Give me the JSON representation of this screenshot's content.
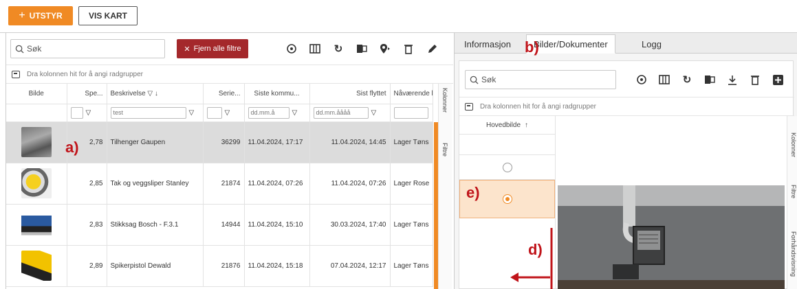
{
  "toolbar": {
    "add_label": "UTSTYR",
    "add_plus": "+",
    "map_label": "VIS KART"
  },
  "left": {
    "search_placeholder": "Søk",
    "clear_label": "Fjern alle filtre",
    "clear_icon": "✕",
    "group_hint": "Dra kolonnen hit for å angi radgrupper",
    "columns": [
      "Bilde",
      "Spe...",
      "Beskrivelse",
      "Serie...",
      "Siste kommu...",
      "Sist flyttet",
      "Nåværende l"
    ],
    "desc_sort": "▽ ↓",
    "filter": {
      "desc_value": "test",
      "date1": "dd.mm.å",
      "date2": "dd.mm.åååå"
    },
    "rows": [
      {
        "spe": "2,78",
        "desc": "Tilhenger Gaupen",
        "serial": "36299",
        "last_comm": "11.04.2024, 17:17",
        "last_moved": "11.04.2024, 14:45",
        "location": "Lager Tøns"
      },
      {
        "spe": "2,85",
        "desc": "Tak og veggsliper Stanley",
        "serial": "21874",
        "last_comm": "11.04.2024, 07:26",
        "last_moved": "11.04.2024, 07:26",
        "location": "Lager Rose"
      },
      {
        "spe": "2,83",
        "desc": "Stikksag Bosch - F.3.1",
        "serial": "14944",
        "last_comm": "11.04.2024, 15:10",
        "last_moved": "30.03.2024, 17:40",
        "location": "Lager Tøns"
      },
      {
        "spe": "2,89",
        "desc": "Spikerpistol Dewald",
        "serial": "21876",
        "last_comm": "11.04.2024, 15:18",
        "last_moved": "07.04.2024, 12:17",
        "location": "Lager Tøns"
      }
    ],
    "strip_columns": "Kolonner",
    "strip_filters": "Filtre"
  },
  "right": {
    "tabs": [
      "Informasjon",
      "Bilder/Dokumenter",
      "Logg"
    ],
    "search_placeholder": "Søk",
    "group_hint": "Dra kolonnen hit for å angi radgrupper",
    "image_col_header": "Hovedbilde",
    "image_col_sort": "↑",
    "strip_columns": "Kolonner",
    "strip_filters": "Filtre",
    "strip_preview": "Forhåndsvisning"
  },
  "annotations": {
    "a": "a)",
    "b": "b)",
    "d": "d)",
    "e": "e)"
  },
  "colors": {
    "accent": "#f08a24",
    "danger": "#a4282b",
    "annotation": "#c0141a"
  }
}
